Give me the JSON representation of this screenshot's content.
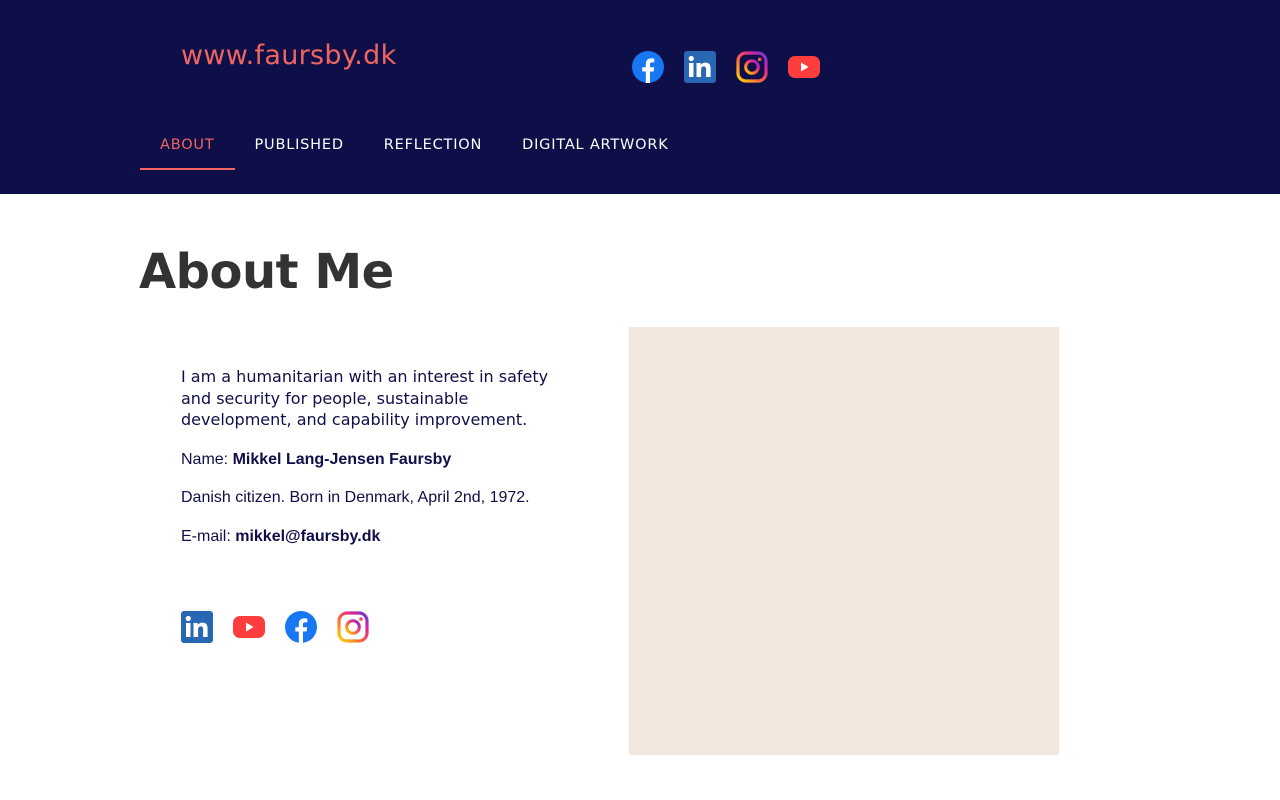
{
  "site": {
    "logo_text": "www.faursby.dk"
  },
  "social_top": [
    {
      "name": "facebook-icon",
      "color": "#1877f2"
    },
    {
      "name": "linkedin-icon",
      "color": "#2867b2"
    },
    {
      "name": "instagram-icon",
      "color": "#d6249f"
    },
    {
      "name": "youtube-icon",
      "color": "#ff3d3d"
    }
  ],
  "nav": {
    "items": [
      {
        "label": "ABOUT",
        "active": true
      },
      {
        "label": "PUBLISHED",
        "active": false
      },
      {
        "label": "REFLECTION",
        "active": false
      },
      {
        "label": "DIGITAL ARTWORK",
        "active": false
      }
    ]
  },
  "main": {
    "title": "About Me",
    "intro": "I am a humanitarian with an interest in safety and security for people, sustainable development, and capability improvement.",
    "name_label": "Name: ",
    "name_value": "Mikkel Lang-Jensen Faursby",
    "born_text": "Danish citizen. Born in Denmark, April 2nd, 1972.",
    "email_label": "E-mail: ",
    "email_value": "mikkel@faursby.dk"
  },
  "social_bottom": [
    {
      "name": "linkedin-icon"
    },
    {
      "name": "youtube-icon"
    },
    {
      "name": "facebook-icon"
    },
    {
      "name": "instagram-icon"
    }
  ],
  "colors": {
    "header_bg": "#0e0e48",
    "accent": "#f0655f",
    "text_dark": "#333333",
    "image_placeholder": "#f4e7de"
  }
}
